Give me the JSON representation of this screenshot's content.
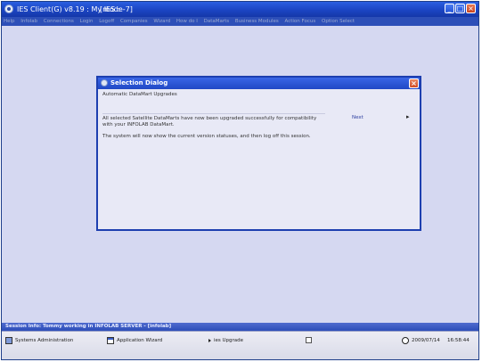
{
  "window": {
    "title": "IES Client(G) v8.19 : My IES :",
    "mode": "[mode-7]",
    "buttons": [
      "_",
      "□",
      "×"
    ]
  },
  "menu": [
    "Help",
    "Infolab",
    "Connections",
    "Login",
    "Logoff",
    "Companies",
    "Wizard",
    "How do I",
    "DataMarts",
    "Business Modules",
    "Action Focus",
    "Option Select"
  ],
  "dialog": {
    "title": "Selection Dialog",
    "heading": "Automatic DataMart Upgrades",
    "message_line1": "All selected Satellite DataMarts have now been upgraded successfully for compatibility",
    "message_line2": "with your INFOLAB DataMart.",
    "message_line3": "The system will now show the current version statuses, and then log off this session.",
    "next_label": "Next",
    "next_arrow": "▸",
    "close_glyph": "×"
  },
  "session": {
    "info": "Session Info: Tommy working in INFOLAB SERVER - [infolab]"
  },
  "taskbar": {
    "items": [
      {
        "label": "Systems Administration",
        "icon": "monitor-icon"
      },
      {
        "label": "Application Wizard",
        "icon": "window-icon"
      },
      {
        "label": "ies Upgrade",
        "icon": "upgrade-icon"
      },
      {
        "label": "",
        "icon": "note-icon"
      }
    ],
    "date": "2009/07/14",
    "time": "16:58:44"
  },
  "colors": {
    "titlebar": "#1c47c6",
    "workspace": "#d5d8f1",
    "dialog_border": "#1d3fb0",
    "close_button": "#cf4a24"
  }
}
